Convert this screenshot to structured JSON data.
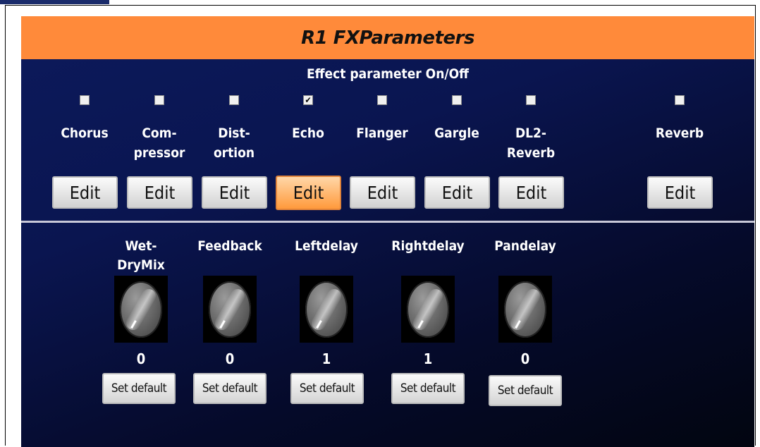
{
  "title": "R1 FXParameters",
  "effects_section_title": "Effect parameter On/Off",
  "effects": [
    {
      "label": "Chorus",
      "checked": false,
      "edit_label": "Edit"
    },
    {
      "label": "Com-\npressor",
      "checked": false,
      "edit_label": "Edit"
    },
    {
      "label": "Dist-\nortion",
      "checked": false,
      "edit_label": "Edit"
    },
    {
      "label": "Echo",
      "checked": true,
      "edit_label": "Edit",
      "active": true
    },
    {
      "label": "Flanger",
      "checked": false,
      "edit_label": "Edit"
    },
    {
      "label": "Gargle",
      "checked": false,
      "edit_label": "Edit"
    },
    {
      "label": "DL2-\nReverb",
      "checked": false,
      "edit_label": "Edit"
    },
    {
      "label": "Reverb",
      "checked": false,
      "edit_label": "Edit"
    }
  ],
  "parameters": [
    {
      "label": "Wet-\nDryMix",
      "value": "0",
      "button_label": "Set default"
    },
    {
      "label": "Feedback",
      "value": "0",
      "button_label": "Set default"
    },
    {
      "label": "Leftdelay",
      "value": "1",
      "button_label": "Set default"
    },
    {
      "label": "Rightdelay",
      "value": "1",
      "button_label": "Set default"
    },
    {
      "label": "Pandelay",
      "value": "0",
      "button_label": "Set default"
    }
  ],
  "colors": {
    "title_bar": "#ff8a3a",
    "panel_bg": "#0a1550",
    "active_button": "#ff9a3c"
  }
}
